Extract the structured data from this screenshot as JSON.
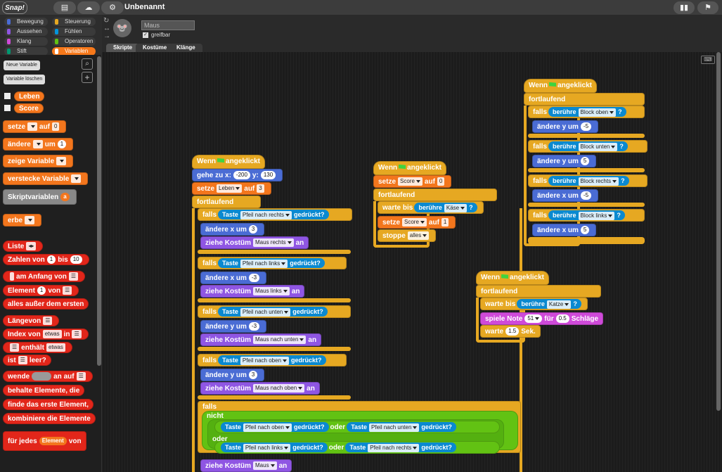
{
  "app": {
    "logo": "Snap!",
    "project_title": "Unbenannt"
  },
  "categories": [
    {
      "name": "Bewegung",
      "color": "#4a6cd4"
    },
    {
      "name": "Steuerung",
      "color": "#e6a822"
    },
    {
      "name": "Aussehen",
      "color": "#8f56e3"
    },
    {
      "name": "Fühlen",
      "color": "#0494dc"
    },
    {
      "name": "Klang",
      "color": "#cf4ad9"
    },
    {
      "name": "Operatoren",
      "color": "#62c213"
    },
    {
      "name": "Stift",
      "color": "#009870"
    },
    {
      "name": "Variablen",
      "color": "#f3761d"
    }
  ],
  "sprite": {
    "name": "Maus",
    "draggable_label": "greifbar"
  },
  "tabs": [
    "Skripte",
    "Kostüme",
    "Klänge"
  ],
  "palette": {
    "new_var": "Neue Variable",
    "del_var": "Variable löschen",
    "vars": [
      "Leben",
      "Score"
    ],
    "set": "setze",
    "to": "auf",
    "val0": "0",
    "change": "ändere",
    "by": "um",
    "val1": "1",
    "show": "zeige Variable",
    "hide": "verstecke Variable",
    "script_vars": "Skriptvariablen",
    "a": "a",
    "inherit": "erbe",
    "list": "Liste",
    "numbers": "Zahlen von",
    "bis": "bis",
    "ten": "10",
    "at_start": "am Anfang von",
    "item": "Element",
    "of": "von",
    "all_but": "alles außer dem ersten",
    "length": "Länge",
    "index_of": "Index von",
    "etwas": "etwas",
    "in": "in",
    "contains": "enthält",
    "is_empty": "ist",
    "leer": "leer?",
    "map": "wende",
    "map_on": "an auf",
    "keep": "behalte Elemente, die",
    "find": "finde das erste Element,",
    "combine": "kombiniere die Elemente",
    "for_each": "für jedes",
    "element": "Element",
    "von": "von"
  },
  "s1": {
    "hat": "Wenn",
    "clicked": "angeklickt",
    "goto": "gehe zu x:",
    "x": "-200",
    "y_lbl": "y:",
    "y": "130",
    "set": "setze",
    "leben": "Leben",
    "auf": "auf",
    "three": "3",
    "forever": "fortlaufend",
    "if": "falls",
    "key": "Taste",
    "pressed": "gedrückt?",
    "right": "Pfeil nach rechts",
    "left": "Pfeil nach links",
    "down": "Pfeil nach unten",
    "up": "Pfeil nach oben",
    "chx": "ändere x um",
    "chy": "ändere y um",
    "p3": "3",
    "m3": "-3",
    "costume": "ziehe Kostüm",
    "an": "an",
    "c_right": "Maus rechts",
    "c_left": "Maus links",
    "c_down": "Maus nach unten",
    "c_up": "Maus nach oben",
    "not": "nicht",
    "or": "oder",
    "c_maus": "Maus"
  },
  "s2": {
    "hat": "Wenn",
    "clicked": "angeklickt",
    "set": "setze",
    "score": "Score",
    "auf": "auf",
    "zero": "0",
    "forever": "fortlaufend",
    "wait_until": "warte bis",
    "touch": "berühre",
    "kaese": "Käse",
    "one": "1",
    "stop": "stoppe",
    "alles": "alles"
  },
  "s3": {
    "hat": "Wenn",
    "clicked": "angeklickt",
    "forever": "fortlaufend",
    "if": "falls",
    "touch": "berühre",
    "top": "Block oben",
    "bottom": "Block unten",
    "right": "Block rechts",
    "left": "Block links",
    "chy": "ändere y um",
    "chx": "ändere x um",
    "m5": "-5",
    "p5": "5"
  },
  "s4": {
    "hat": "Wenn",
    "clicked": "angeklickt",
    "forever": "fortlaufend",
    "wait_until": "warte bis",
    "touch": "berühre",
    "katze": "Katze",
    "play": "spiele Note",
    "note": "51",
    "for": "für",
    "beats_val": "0.5",
    "beats": "Schläge",
    "wait": "warte",
    "secs_val": "1.5",
    "secs": "Sek."
  }
}
